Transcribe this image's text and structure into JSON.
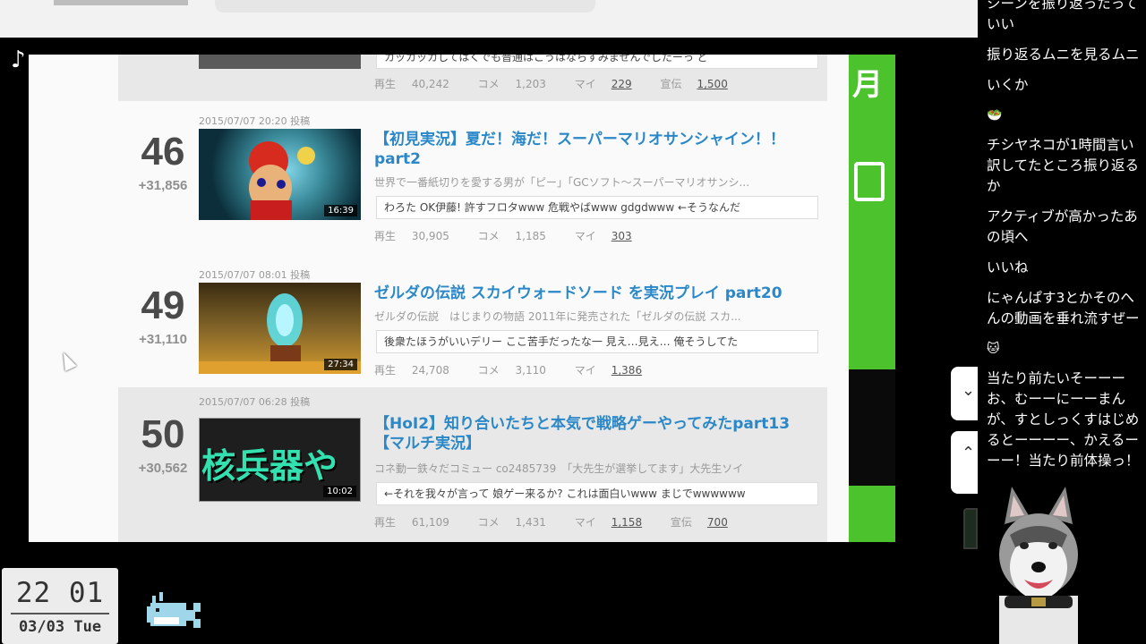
{
  "video": {
    "rows": [
      {
        "stats": {
          "views_label": "再生",
          "views": "40,242",
          "comments_label": "コメ",
          "comments": "1,203",
          "mylists_label": "マイ",
          "mylists": "229",
          "ads_label": "宣伝",
          "ads": "1,500"
        },
        "comment": "カッカッカしてはくでも普通はこうはならすみませんでしたーっ ど"
      },
      {
        "rank": "46",
        "delta": "+31,856",
        "date": "2015/07/07 20:20 投稿",
        "duration": "16:39",
        "title": "【初見実況】夏だ！海だ！スーパーマリオサンシャイン！！part2",
        "description": "世界で一番紙切りを愛する男が「ピー」「GCソフト～スーパーマリオサンシ...",
        "comment": "わろた OK伊藤! 許すフロタwww 危戦やばwww gdgdwww ←そうなんだ",
        "stats": {
          "views_label": "再生",
          "views": "30,905",
          "comments_label": "コメ",
          "comments": "1,185",
          "mylists_label": "マイ",
          "mylists": "303"
        }
      },
      {
        "rank": "49",
        "delta": "+31,110",
        "date": "2015/07/07 08:01 投稿",
        "duration": "27:34",
        "title": "ゼルダの伝説 スカイウォードソード を実況プレイ part20",
        "description": "ゼルダの伝説　はじまりの物語 2011年に発売された「ゼルダの伝説 スカ...",
        "comment": "後衆たほうがいいデリー ここ苦手だったな一 見え…見え… 俺そうしてた",
        "stats": {
          "views_label": "再生",
          "views": "24,708",
          "comments_label": "コメ",
          "comments": "3,110",
          "mylists_label": "マイ",
          "mylists": "1,386"
        }
      },
      {
        "rank": "50",
        "delta": "+30,562",
        "date": "2015/07/07 06:28 投稿",
        "duration": "10:02",
        "thumb_text": "核兵器や",
        "title": "【HoI2】知り合いたちと本気で戦略ゲーやってみたpart13【マルチ実況】",
        "description": "コネ動一鉄々だコミュー co2485739　「大先生が選挙してます」大先生ソイ",
        "comment": "←それを我々が言って 娘ゲー来るか? これは面白いwww まじでwwwwww",
        "stats": {
          "views_label": "再生",
          "views": "61,109",
          "comments_label": "コメ",
          "comments": "1,431",
          "mylists_label": "マイ",
          "mylists": "1,158",
          "ads_label": "宣伝",
          "ads": "700"
        }
      }
    ],
    "side_text": "月"
  },
  "chat": {
    "messages": [
      "シーンを振り返ったっていい",
      "振り返るムニを見るムニ",
      "いくか",
      "🥗",
      "チシヤネコが1時間言い訳してたところ振り返るか",
      "アクティブが高かったあの頃へ",
      "いいね",
      "にゃんぱす3とかそのへんの動画を垂れ流すぜー",
      "🐱",
      "当たり前たいそーーーお、むーーにーーまんが、すとしっくすはじめるとーーーー、かえるーーー！当たり前体操っ！"
    ]
  },
  "clock": {
    "time": "22 01",
    "date": "03/03 Tue"
  },
  "icons": {
    "player": "player-logo-icon",
    "cursor": "mouse-cursor-icon",
    "whale": "pixel-whale-icon",
    "avatar": "husky-avatar"
  }
}
